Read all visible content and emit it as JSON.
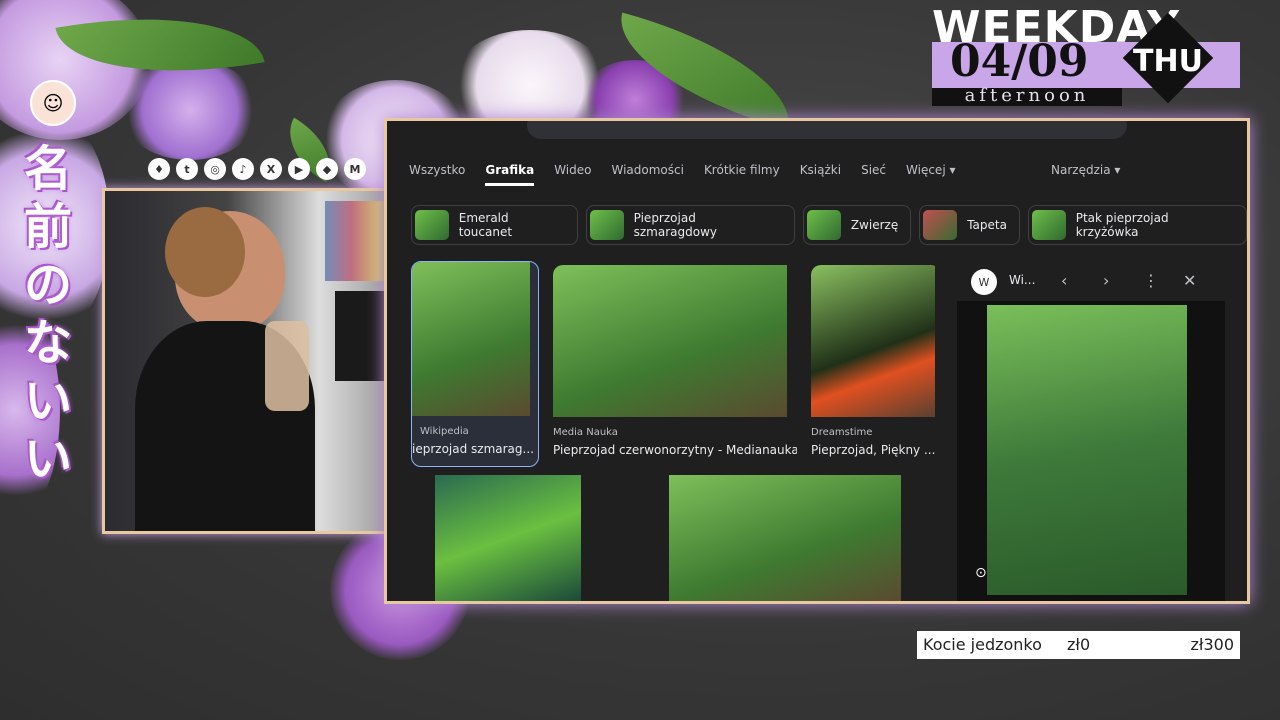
{
  "overlay": {
    "vertical_text": [
      "名",
      "前",
      "の",
      "な",
      "い",
      "い"
    ],
    "socials": [
      "♦",
      "t",
      "◎",
      "♪",
      "X",
      "▶",
      "◆",
      "M"
    ]
  },
  "weekday": {
    "title": "WEEKDAY",
    "date": "04/09",
    "day": "THU",
    "part": "afternoon"
  },
  "goal": {
    "label": "Kocie jedzonko",
    "current": "zł0",
    "target": "zł300"
  },
  "browser": {
    "tabs": [
      "Wszystko",
      "Grafika",
      "Wideo",
      "Wiadomości",
      "Krótkie filmy",
      "Książki",
      "Sieć",
      "Więcej ▾"
    ],
    "active_tab": "Grafika",
    "tools": "Narzędzia ▾",
    "chips": [
      "Emerald toucanet",
      "Pieprzojad szmaragdowy",
      "Zwierzę",
      "Tapeta",
      "Ptak pieprzojad krzyżówka"
    ],
    "results": [
      {
        "source": "Wikipedia",
        "title": "ieprzojad szmarag..."
      },
      {
        "source": "Media Nauka",
        "title": "Pieprzojad czerwonorzytny - Medianauka..."
      },
      {
        "source": "Dreamstime",
        "title": "Pieprzojad, Piękny ..."
      }
    ],
    "panel": {
      "logo": "W",
      "title": "Wi...",
      "icons": {
        "prev": "‹",
        "next": "›",
        "more": "⋮",
        "close": "✕"
      }
    }
  },
  "colors": {
    "accent": "#c9a6e8",
    "frame": "#e8c8a0",
    "bg": "#1f1f1f"
  }
}
